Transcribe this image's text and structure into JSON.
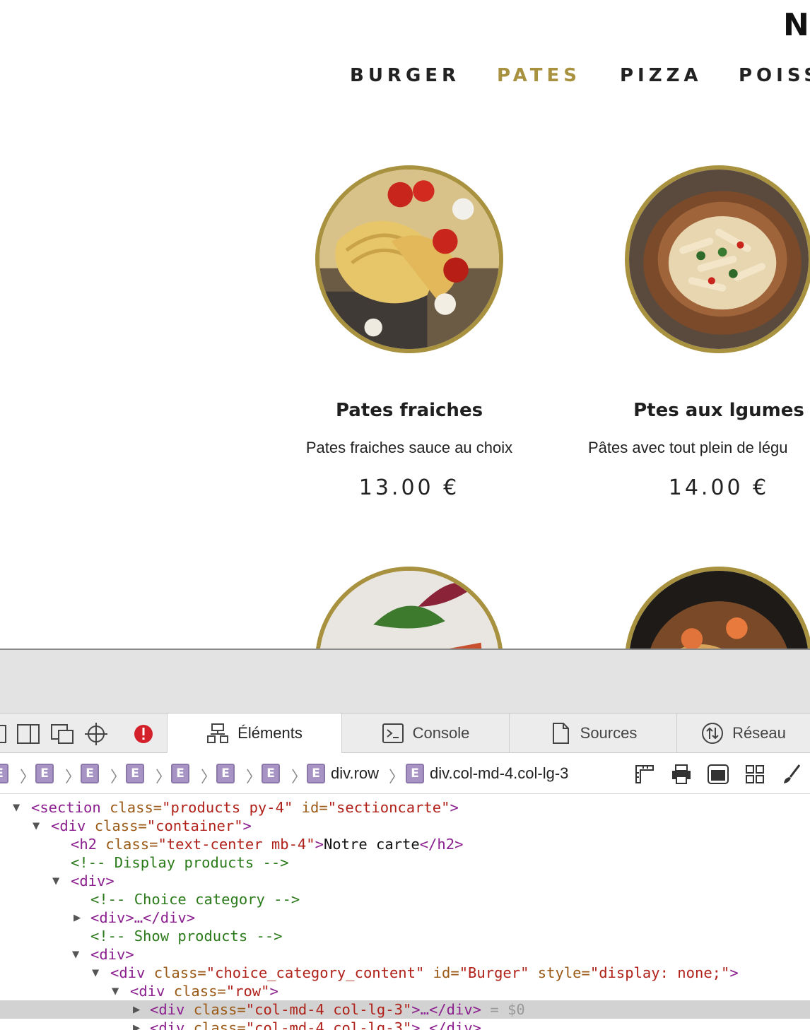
{
  "page": {
    "brand_partial": "N",
    "nav": [
      {
        "label": "BURGER",
        "active": false
      },
      {
        "label": "PATES",
        "active": true
      },
      {
        "label": "PIZZA",
        "active": false
      },
      {
        "label": "POISS",
        "active": false
      }
    ],
    "accent_color": "#a8913f",
    "products": [
      {
        "title": "Pates fraiches",
        "description": "Pates fraiches sauce au choix",
        "price": "13.00 €"
      },
      {
        "title": "Ptes aux lgumes",
        "description": "Pâtes avec tout plein de légu",
        "price": "14.00 €"
      }
    ]
  },
  "devtools": {
    "tabs": [
      {
        "label": "Éléments",
        "icon": "elements-icon",
        "active": true
      },
      {
        "label": "Console",
        "icon": "console-icon",
        "active": false
      },
      {
        "label": "Sources",
        "icon": "sources-icon",
        "active": false
      },
      {
        "label": "Réseau",
        "icon": "network-icon",
        "active": false
      }
    ],
    "breadcrumb_badge": "E",
    "breadcrumb_labels": [
      "div.row",
      "div.col-md-4.col-lg-3"
    ],
    "tree": {
      "l1_tag": "<section",
      "l1_a1": " class=",
      "l1_v1": "\"products py-4\"",
      "l1_a2": " id=",
      "l1_v2": "\"sectioncarte\"",
      "l1_end": ">",
      "l2_tag": "<div",
      "l2_a1": " class=",
      "l2_v1": "\"container\"",
      "l2_end": ">",
      "l3_tag": "<h2",
      "l3_a1": " class=",
      "l3_v1": "\"text-center mb-4\"",
      "l3_gt": ">",
      "l3_text": "Notre carte",
      "l3_close": "</h2>",
      "l4_comment": "<!-- Display products -->",
      "l5_tag": "<div>",
      "l6_comment": "<!-- Choice category -->",
      "l7_tag": "<div>…</div>",
      "l8_comment": "<!-- Show products -->",
      "l9_tag": "<div>",
      "l10_tag": "<div",
      "l10_a1": " class=",
      "l10_v1": "\"choice_category_content\"",
      "l10_a2": " id=",
      "l10_v2": "\"Burger\"",
      "l10_a3": " style=",
      "l10_v3": "\"display: none;\"",
      "l10_end": ">",
      "l11_tag": "<div",
      "l11_a1": " class=",
      "l11_v1": "\"row\"",
      "l11_end": ">",
      "l12_tag": "<div",
      "l12_a1": " class=",
      "l12_v1": "\"col-md-4 col-lg-3\"",
      "l12_end": ">…</div>",
      "l12_dollar": " = $0",
      "l13_tag": "<div",
      "l13_a1": " class=",
      "l13_v1": "\"col-md-4 col-lg-3\"",
      "l13_end": ">…</div>"
    }
  }
}
